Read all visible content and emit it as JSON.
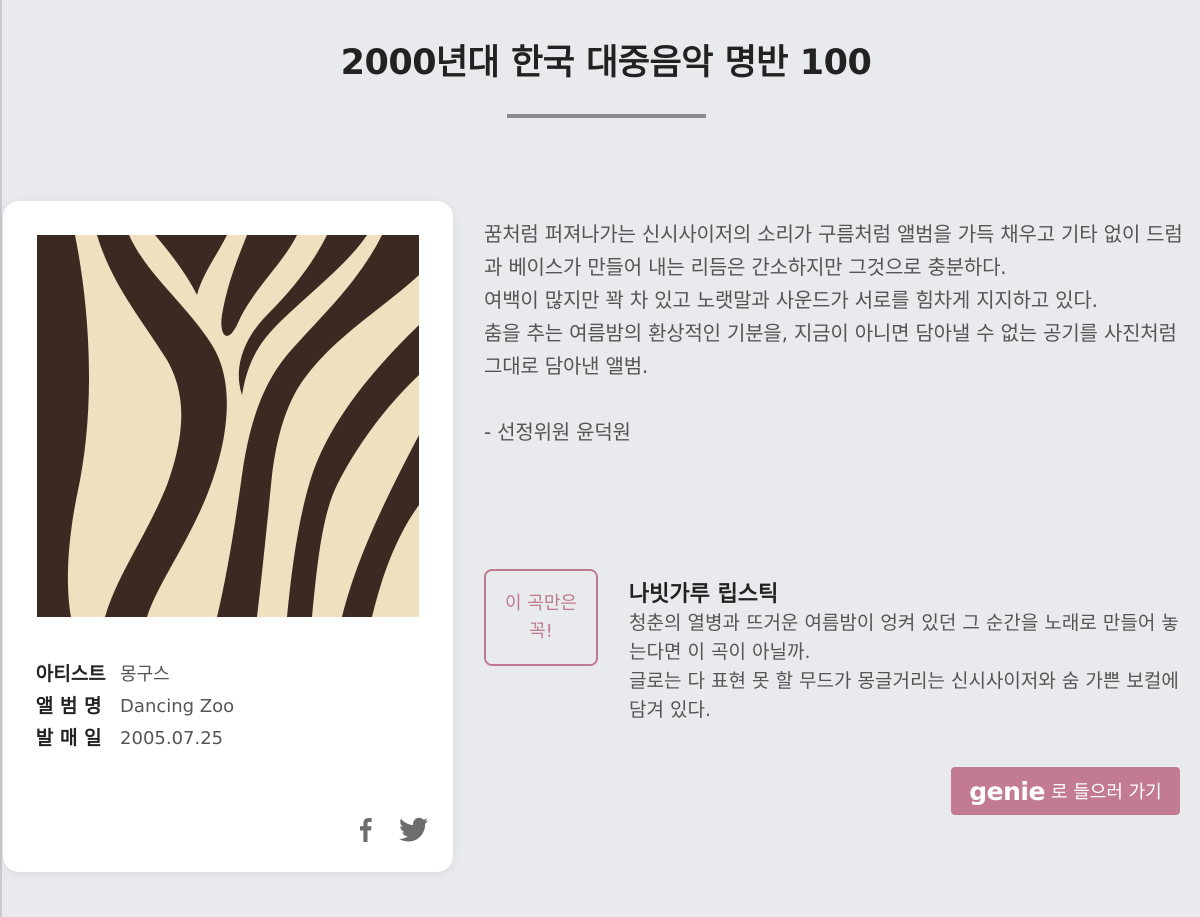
{
  "page": {
    "title": "2000년대 한국 대중음악 명반 100"
  },
  "album": {
    "cover_icon": "zebra-stripe-album-cover",
    "artist_label": "아티스트",
    "artist": "몽구스",
    "album_label": "앨 범 명",
    "album_name": "Dancing Zoo",
    "release_label": "발 매 일",
    "release_date": "2005.07.25",
    "share_icons": [
      "facebook-icon",
      "twitter-icon"
    ]
  },
  "review": {
    "paragraphs": [
      "꿈처럼 퍼져나가는 신시사이저의 소리가 구름처럼 앨범을 가득 채우고 기타 없이 드럼과 베이스가 만들어 내는 리듬은 간소하지만 그것으로 충분하다.",
      "여백이 많지만 꽉 차 있고 노랫말과 사운드가 서로를 힘차게 지지하고 있다.",
      "춤을 추는 여름밤의 환상적인 기분을, 지금이 아니면 담아낼 수 없는 공기를 사진처럼 그대로 담아낸 앨범."
    ],
    "reviewer": "- 선정위원 윤덕원"
  },
  "recommend": {
    "badge_line1": "이 곡만은",
    "badge_line2": "꼭!",
    "track_title": "나빗가루 립스틱",
    "desc_paragraphs": [
      "청춘의 열병과 뜨거운 여름밤이 엉켜 있던 그 순간을 노래로 만들어 놓는다면 이 곡이 아닐까.",
      "글로는 다 표현 못 할 무드가 몽글거리는 신시사이저와 숨 가쁜 보컬에 담겨 있다."
    ]
  },
  "genie": {
    "logo": "genie",
    "label": "로 들으러 가기"
  },
  "colors": {
    "background": "#e9eaee",
    "accent": "#c27b91",
    "badge_border": "#c07a90"
  }
}
